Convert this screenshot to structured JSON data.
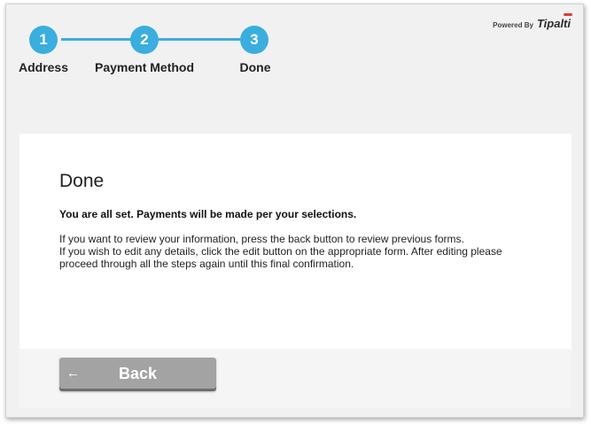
{
  "stepper": {
    "steps": [
      {
        "number": "1",
        "label": "Address"
      },
      {
        "number": "2",
        "label": "Payment Method"
      },
      {
        "number": "3",
        "label": "Done"
      }
    ]
  },
  "branding": {
    "powered_by": "Powered By",
    "brand_name": "Tipalti"
  },
  "card": {
    "title": "Done",
    "confirmation": "You are all set. Payments will be made per your selections.",
    "info_lines": [
      "If you want to review your information, press the back button to review previous forms.",
      "If you wish to edit any details, click the edit button on the appropriate form. After editing please proceed through all the steps again until this final confirmation."
    ]
  },
  "footer": {
    "back_label": "Back",
    "back_icon": "arrow-left-icon"
  },
  "colors": {
    "accent": "#3aaede",
    "button": "#a3a3a3",
    "brand_accent": "#e03a3a"
  }
}
